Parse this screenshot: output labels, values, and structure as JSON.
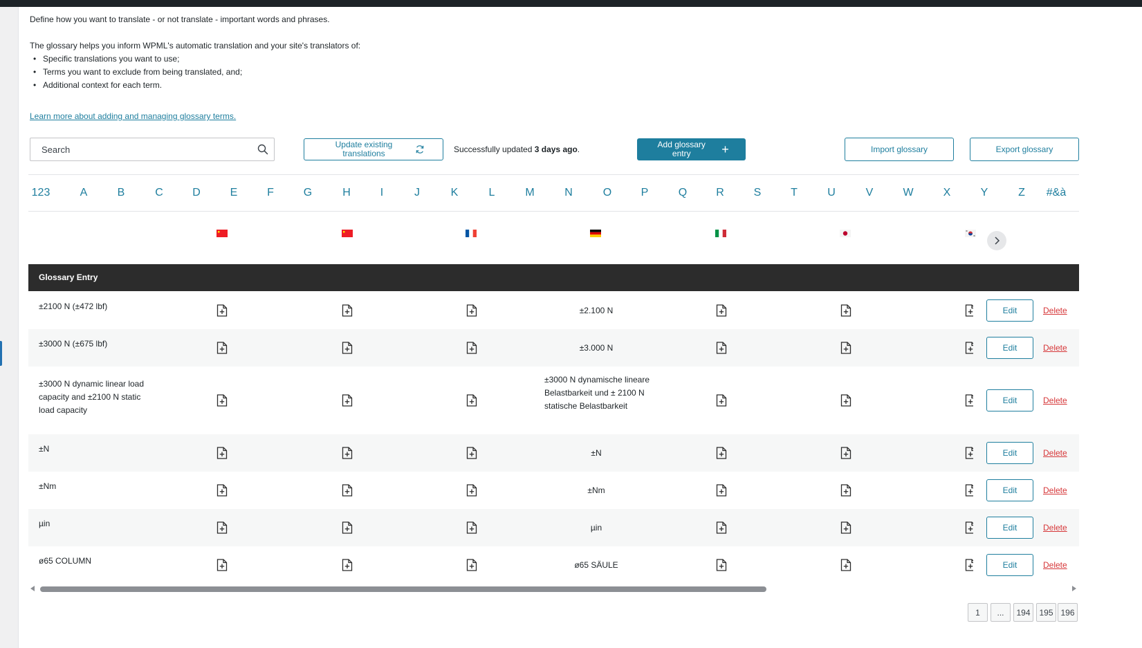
{
  "intro": {
    "line1": "Define how you want to translate - or not translate - important words and phrases.",
    "line2": "The glossary helps you inform WPML's automatic translation and your site's translators of:",
    "bullets": [
      "Specific translations you want to use;",
      "Terms you want to exclude from being translated, and;",
      "Additional context for each term."
    ],
    "learn_link": "Learn more about adding and managing glossary terms."
  },
  "toolbar": {
    "search_placeholder": "Search",
    "update_label": "Update existing translations",
    "status_prefix": "Successfully updated ",
    "status_bold": "3 days ago",
    "status_suffix": ".",
    "add_label": "Add glossary entry",
    "import_label": "Import glossary",
    "export_label": "Export glossary"
  },
  "alphabet": [
    "123",
    "A",
    "B",
    "C",
    "D",
    "E",
    "F",
    "G",
    "H",
    "I",
    "J",
    "K",
    "L",
    "M",
    "N",
    "O",
    "P",
    "Q",
    "R",
    "S",
    "T",
    "U",
    "V",
    "W",
    "X",
    "Y",
    "Z",
    "#&à"
  ],
  "languages": [
    {
      "name": "chinese-simplified-flag",
      "color": "#ee1c25"
    },
    {
      "name": "chinese-traditional-flag",
      "color": "#ee1c25"
    },
    {
      "name": "french-flag",
      "color": "#0055a4"
    },
    {
      "name": "german-flag",
      "color": "#000000"
    },
    {
      "name": "italian-flag",
      "color": "#009246"
    },
    {
      "name": "japanese-flag",
      "color": "#bc002d"
    },
    {
      "name": "korean-flag",
      "color": "#cd2e3a"
    }
  ],
  "table": {
    "header": "Glossary Entry",
    "edit_label": "Edit",
    "delete_label": "Delete",
    "rows": [
      {
        "term": "±2100 N (±472 lbf)",
        "de": "±2.100 N"
      },
      {
        "term": "±3000 N (±675 lbf)",
        "de": "±3.000 N"
      },
      {
        "term": "±3000 N dynamic linear load capacity and ±2100 N static load capacity",
        "de": "±3000 N dynamische lineare Belastbarkeit und ± 2100 N statische Belastbarkeit"
      },
      {
        "term": "±N",
        "de": "±N"
      },
      {
        "term": "±Nm",
        "de": "±Nm"
      },
      {
        "term": "µin",
        "de": "µin"
      },
      {
        "term": "ø65 COLUMN",
        "de": "ø65 SÄULE"
      }
    ]
  },
  "pagination": {
    "pages": [
      "1",
      "...",
      "194",
      "195",
      "196"
    ]
  },
  "colors": {
    "accent": "#1e7e9e",
    "delete": "#d63638",
    "table_header": "#2c2c2c"
  }
}
